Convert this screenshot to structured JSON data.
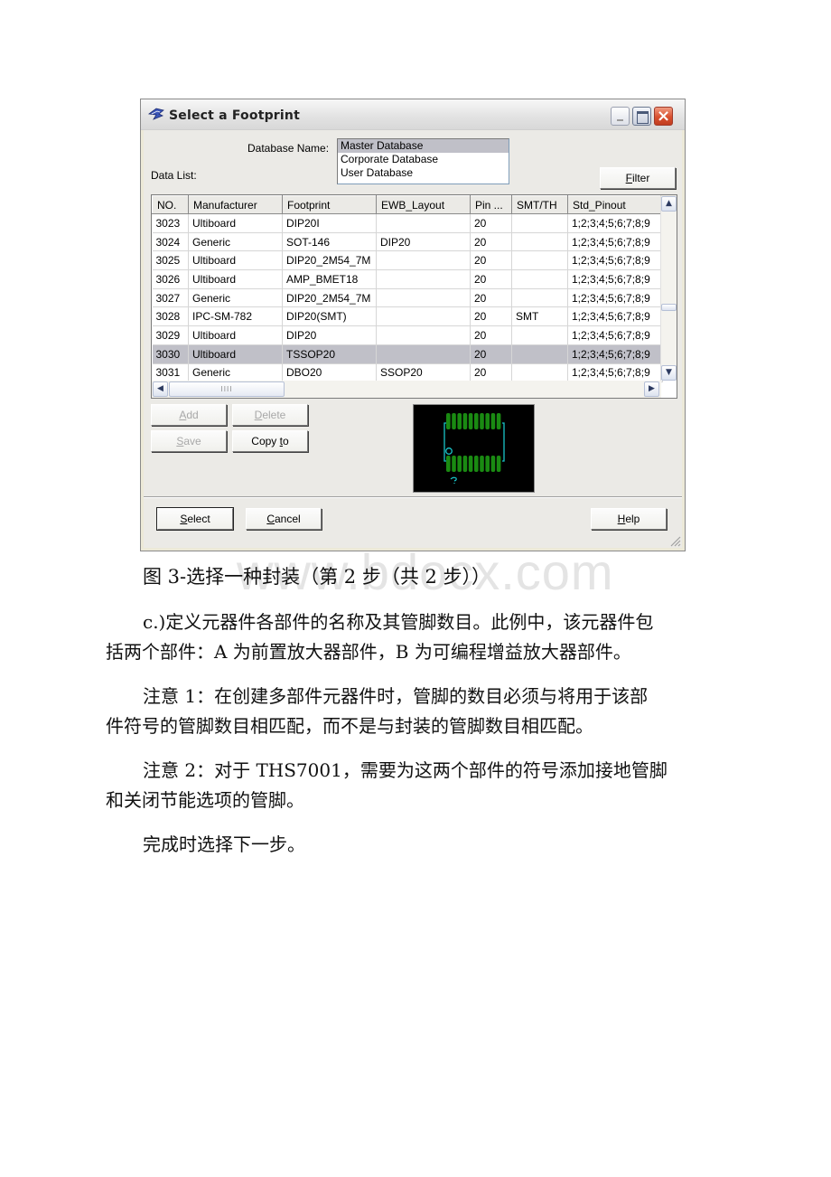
{
  "dialog": {
    "title": "Select a Footprint",
    "window_controls": {
      "minimize": "minimize",
      "maximize": "maximize",
      "close": "×"
    },
    "database_name_label": "Database Name:",
    "data_list_label": "Data List:",
    "databases": [
      {
        "label": "Master Database",
        "selected": true
      },
      {
        "label": "Corporate Database",
        "selected": false
      },
      {
        "label": "User Database",
        "selected": false
      }
    ],
    "filter_button": {
      "label_pre": "",
      "mnemonic": "F",
      "label_post": "ilter"
    },
    "table": {
      "columns": [
        "NO.",
        "Manufacturer",
        "Footprint",
        "EWB_Layout",
        "Pin ...",
        "SMT/TH",
        "Std_Pinout"
      ],
      "rows": [
        {
          "no": "3023",
          "manufacturer": "Ultiboard",
          "footprint": "DIP20I",
          "ewb_layout": "",
          "pins": "20",
          "smt_th": "",
          "std_pinout": "1;2;3;4;5;6;7;8;9",
          "selected": false
        },
        {
          "no": "3024",
          "manufacturer": "Generic",
          "footprint": "SOT-146",
          "ewb_layout": "DIP20",
          "pins": "20",
          "smt_th": "",
          "std_pinout": "1;2;3;4;5;6;7;8;9",
          "selected": false
        },
        {
          "no": "3025",
          "manufacturer": "Ultiboard",
          "footprint": "DIP20_2M54_7M",
          "ewb_layout": "",
          "pins": "20",
          "smt_th": "",
          "std_pinout": "1;2;3;4;5;6;7;8;9",
          "selected": false
        },
        {
          "no": "3026",
          "manufacturer": "Ultiboard",
          "footprint": "AMP_BMET18",
          "ewb_layout": "",
          "pins": "20",
          "smt_th": "",
          "std_pinout": "1;2;3;4;5;6;7;8;9",
          "selected": false
        },
        {
          "no": "3027",
          "manufacturer": "Generic",
          "footprint": "DIP20_2M54_7M",
          "ewb_layout": "",
          "pins": "20",
          "smt_th": "",
          "std_pinout": "1;2;3;4;5;6;7;8;9",
          "selected": false
        },
        {
          "no": "3028",
          "manufacturer": "IPC-SM-782",
          "footprint": "DIP20(SMT)",
          "ewb_layout": "",
          "pins": "20",
          "smt_th": "SMT",
          "std_pinout": "1;2;3;4;5;6;7;8;9",
          "selected": false
        },
        {
          "no": "3029",
          "manufacturer": "Ultiboard",
          "footprint": "DIP20",
          "ewb_layout": "",
          "pins": "20",
          "smt_th": "",
          "std_pinout": "1;2;3;4;5;6;7;8;9",
          "selected": false
        },
        {
          "no": "3030",
          "manufacturer": "Ultiboard",
          "footprint": "TSSOP20",
          "ewb_layout": "",
          "pins": "20",
          "smt_th": "",
          "std_pinout": "1;2;3;4;5;6;7;8;9",
          "selected": true
        },
        {
          "no": "3031",
          "manufacturer": "Generic",
          "footprint": "DBO20",
          "ewb_layout": "SSOP20",
          "pins": "20",
          "smt_th": "",
          "std_pinout": "1;2;3;4;5;6;7;8;9",
          "selected": false
        }
      ]
    },
    "scroll": {
      "up": "▲",
      "down": "▼",
      "left": "◀",
      "right": "▶",
      "thumb_grip": "IIII"
    },
    "buttons": {
      "add": {
        "mnemonic": "A",
        "rest": "dd",
        "enabled": false
      },
      "delete": {
        "mnemonic": "D",
        "rest": "elete",
        "enabled": false
      },
      "save": {
        "mnemonic": "S",
        "rest": "ave",
        "enabled": false
      },
      "copy_to": {
        "pre": "Copy ",
        "mnemonic": "t",
        "rest": "o",
        "enabled": true
      },
      "select": {
        "mnemonic": "S",
        "rest": "elect",
        "enabled": true
      },
      "cancel": {
        "mnemonic": "C",
        "rest": "ancel",
        "enabled": true
      },
      "help": {
        "mnemonic": "H",
        "rest": "elp",
        "enabled": true
      }
    },
    "preview": {
      "description": "TSSOP20 footprint preview",
      "pad_color": "#1a8a12",
      "outline_color": "#19c4c8",
      "background": "#000000",
      "pads_per_side": 10
    }
  },
  "document": {
    "watermark": "www.bdocx.com",
    "caption": "图 3-选择一种封装（第 2 步（共 2 步））",
    "paragraphs": [
      {
        "lines": [
          "c.)定义元器件各部件的名称及其管脚数目。此例中，该元器件包",
          "括两个部件：A 为前置放大器部件，B 为可编程增益放大器部件。"
        ]
      },
      {
        "lines": [
          "注意 1：在创建多部件元器件时，管脚的数目必须与将用于该部",
          "件符号的管脚数目相匹配，而不是与封装的管脚数目相匹配。"
        ]
      },
      {
        "lines": [
          "注意 2：对于 THS7001，需要为这两个部件的符号添加接地管脚",
          "和关闭节能选项的管脚。"
        ]
      },
      {
        "lines": [
          "完成时选择下一步。"
        ]
      }
    ]
  }
}
